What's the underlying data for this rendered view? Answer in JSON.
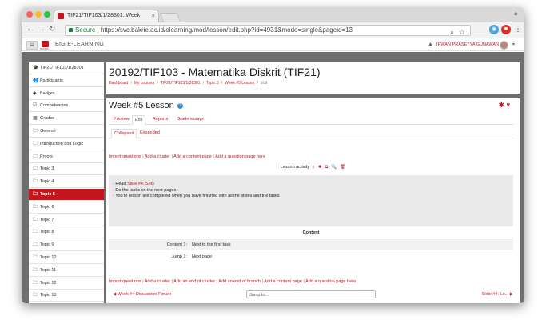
{
  "browser": {
    "tab_title": "TIF21/TIF103/1/28301: Week",
    "url_secure": "Secure",
    "url_sep": " | ",
    "url_text": "https://svc.bakrie.ac.id/elearning/mod/lesson/edit.php?id=4931&mode=single&pageid=13",
    "tab_close": "×"
  },
  "site": {
    "menu_icon": "≡",
    "logo_text": "BAKRIE",
    "brand": "BIG E-LEARNING",
    "user_name": "IRWAN PRASETYA GUNAWAN",
    "bell_icon": "▲",
    "caret": "▾"
  },
  "sidebar": {
    "items": [
      {
        "label": "TIF21/TIF103/1/28301",
        "icon": "cap-icon",
        "glyph": "🎓"
      },
      {
        "label": "Participants",
        "icon": "users-icon",
        "glyph": "👥"
      },
      {
        "label": "Badges",
        "icon": "badge-icon",
        "glyph": "◆"
      },
      {
        "label": "Competencies",
        "icon": "check-icon",
        "glyph": "☑"
      },
      {
        "label": "Grades",
        "icon": "grades-icon",
        "glyph": "▦"
      },
      {
        "label": "General",
        "icon": "folder-icon",
        "glyph": "🗀"
      },
      {
        "label": "Introduction and Logic",
        "icon": "folder-icon",
        "glyph": "🗀"
      },
      {
        "label": "Proofs",
        "icon": "folder-icon",
        "glyph": "🗀"
      },
      {
        "label": "Topic 3",
        "icon": "folder-icon",
        "glyph": "🗀"
      },
      {
        "label": "Topic 4",
        "icon": "folder-icon",
        "glyph": "🗀"
      },
      {
        "label": "Topic 5",
        "icon": "folder-icon",
        "glyph": "🗀",
        "active": true
      },
      {
        "label": "Topic 6",
        "icon": "folder-icon",
        "glyph": "🗀"
      },
      {
        "label": "Topic 7",
        "icon": "folder-icon",
        "glyph": "🗀"
      },
      {
        "label": "Topic 8",
        "icon": "folder-icon",
        "glyph": "🗀"
      },
      {
        "label": "Topic 9",
        "icon": "folder-icon",
        "glyph": "🗀"
      },
      {
        "label": "Topic 10",
        "icon": "folder-icon",
        "glyph": "🗀"
      },
      {
        "label": "Topic 11",
        "icon": "folder-icon",
        "glyph": "🗀"
      },
      {
        "label": "Topic 12",
        "icon": "folder-icon",
        "glyph": "🗀"
      },
      {
        "label": "Topic 13",
        "icon": "folder-icon",
        "glyph": "🗀"
      }
    ]
  },
  "header": {
    "course_title": "20192/TIF103 - Matematika Diskrit (TIF21)",
    "breadcrumb": [
      "Dashboard",
      "My courses",
      "TIF21/TIF103/1/28301",
      "Topic 5",
      "Week #5 Lesson",
      "Edit"
    ],
    "breadcrumb_sep": "/"
  },
  "lesson": {
    "title": "Week #5 Lesson",
    "help": "?",
    "gear": "✱ ▾",
    "tabs": [
      "Preview",
      "Edit",
      "Reports",
      "Grade essays"
    ],
    "subtabs": [
      "Collapsed",
      "Expanded"
    ],
    "top_links": [
      "Import questions",
      "Add a cluster",
      "Add a content page",
      "Add a question page here"
    ],
    "link_sep": " | ",
    "activity_title": "Lesson activity",
    "action_icons": [
      "↕",
      "✱",
      "⧉",
      "🔍",
      "🗑"
    ],
    "content_pre": "Read ",
    "content_link": "Slide #4: Sets",
    "content_lines": [
      "Do the tasks on the next pages",
      "You're lesson are completed when you have finished with all the slides and the tasks"
    ],
    "content_header": "Content",
    "rows": [
      {
        "k": "Content 1:",
        "v": "Next to the first task"
      },
      {
        "k": "Jump 1:",
        "v": "Next page"
      }
    ],
    "bottom_links": [
      "Import questions",
      "Add a cluster",
      "Add an end of cluster",
      "Add an end of branch",
      "Add a content page",
      "Add a question page here"
    ],
    "prev_link": "◀ Week #4 Discussion Forum",
    "jump_label": "Jump to...",
    "next_link": "Slide #4: Lo... ▶"
  },
  "colors": {
    "accent": "#c4161c"
  }
}
